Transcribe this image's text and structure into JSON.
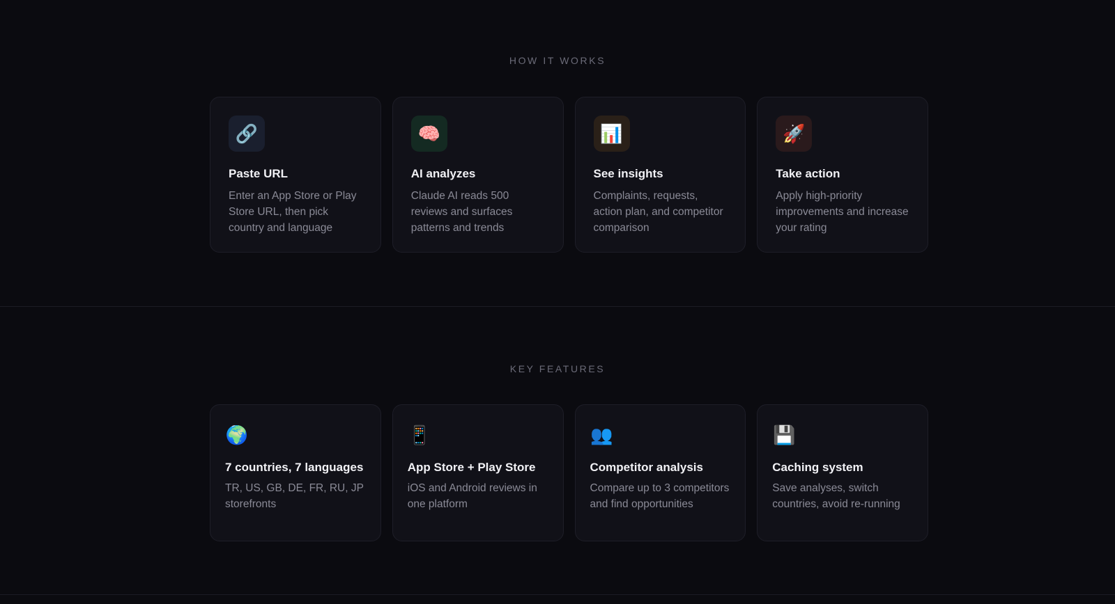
{
  "how_it_works": {
    "heading": "HOW IT WORKS",
    "steps": [
      {
        "icon": "link-icon",
        "glyph": "🔗",
        "tile_color": "#1a1f2e",
        "title": "Paste URL",
        "description": "Enter an App Store or Play Store URL, then pick country and language"
      },
      {
        "icon": "brain-icon",
        "glyph": "🧠",
        "tile_color": "#142a22",
        "title": "AI analyzes",
        "description": "Claude AI reads 500 reviews and surfaces patterns and trends"
      },
      {
        "icon": "bar-chart-icon",
        "glyph": "📊",
        "tile_color": "#2a2018",
        "title": "See insights",
        "description": "Complaints, requests, action plan, and competitor comparison"
      },
      {
        "icon": "rocket-icon",
        "glyph": "🚀",
        "tile_color": "#2a1a1c",
        "title": "Take action",
        "description": "Apply high-priority improvements and increase your rating"
      }
    ]
  },
  "key_features": {
    "heading": "KEY FEATURES",
    "features": [
      {
        "icon": "globe-icon",
        "glyph": "🌍",
        "title": "7 countries, 7 languages",
        "description": "TR, US, GB, DE, FR, RU, JP storefronts"
      },
      {
        "icon": "mobile-phone-icon",
        "glyph": "📱",
        "title": "App Store + Play Store",
        "description": "iOS and Android reviews in one platform"
      },
      {
        "icon": "users-icon",
        "glyph": "👥",
        "title": "Competitor analysis",
        "description": "Compare up to 3 competitors and find opportunities"
      },
      {
        "icon": "floppy-disk-icon",
        "glyph": "💾",
        "title": "Caching system",
        "description": "Save analyses, switch countries, avoid re-running"
      }
    ]
  }
}
